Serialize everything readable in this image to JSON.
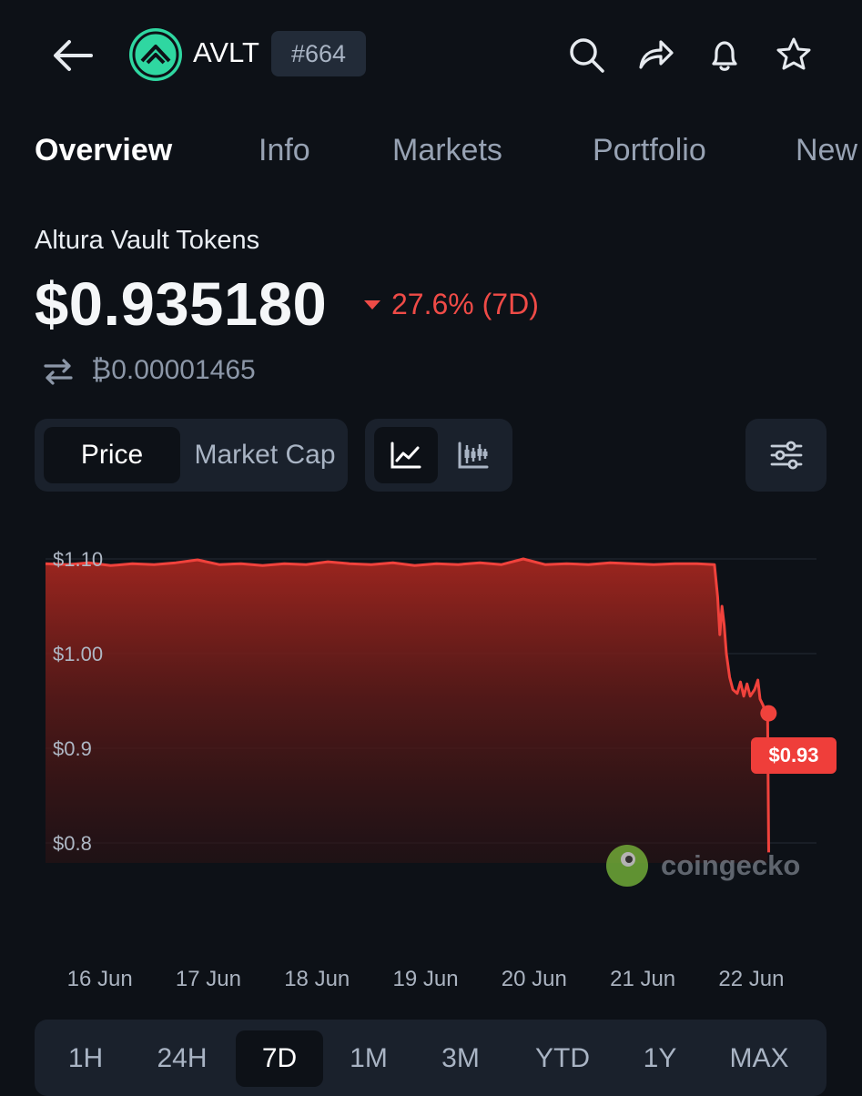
{
  "header": {
    "back_icon": "arrow-left-icon",
    "coin_logo_icon": "avlt-logo-icon",
    "symbol": "AVLT",
    "rank": "#664",
    "actions": [
      "search-icon",
      "share-icon",
      "bell-icon",
      "star-icon"
    ]
  },
  "tabs": [
    {
      "label": "Overview",
      "active": true
    },
    {
      "label": "Info"
    },
    {
      "label": "Markets"
    },
    {
      "label": "Portfolio"
    },
    {
      "label": "New"
    }
  ],
  "coin": {
    "name": "Altura Vault Tokens",
    "price": "$0.935180",
    "change": "27.6% (7D)",
    "change_direction": "down",
    "btc_price": "₿0.00001465"
  },
  "toggles": {
    "metric": [
      "Price",
      "Market Cap"
    ],
    "metric_selected": "Price",
    "chart_types": [
      "line-chart-icon",
      "candlestick-icon"
    ],
    "chart_type_selected": "line-chart-icon",
    "settings_icon": "sliders-icon"
  },
  "colors": {
    "background": "#0d1117",
    "down": "#ef4b47",
    "panel": "#1a212c",
    "coin_logo": "#2fd7a1"
  },
  "chart_data": {
    "type": "area",
    "y_ticks": [
      "$1.10",
      "$1.00",
      "$0.9",
      "$0.8"
    ],
    "y_tick_values": [
      1.1,
      1.0,
      0.9,
      0.8
    ],
    "ylim": [
      0.77,
      1.1
    ],
    "x_ticks": [
      "16 Jun",
      "17 Jun",
      "18 Jun",
      "19 Jun",
      "20 Jun",
      "21 Jun",
      "22 Jun"
    ],
    "x_tick_positions": [
      0.5,
      1.5,
      2.5,
      3.5,
      4.5,
      5.5,
      6.5
    ],
    "xlim": [
      0,
      7.1
    ],
    "series": [
      {
        "values": [
          [
            0.0,
            1.095
          ],
          [
            0.2,
            1.094
          ],
          [
            0.4,
            1.096
          ],
          [
            0.6,
            1.093
          ],
          [
            0.8,
            1.095
          ],
          [
            1.0,
            1.094
          ],
          [
            1.2,
            1.096
          ],
          [
            1.4,
            1.099
          ],
          [
            1.6,
            1.094
          ],
          [
            1.8,
            1.095
          ],
          [
            2.0,
            1.093
          ],
          [
            2.2,
            1.095
          ],
          [
            2.4,
            1.094
          ],
          [
            2.6,
            1.097
          ],
          [
            2.8,
            1.095
          ],
          [
            3.0,
            1.094
          ],
          [
            3.2,
            1.096
          ],
          [
            3.4,
            1.093
          ],
          [
            3.6,
            1.095
          ],
          [
            3.8,
            1.094
          ],
          [
            4.0,
            1.096
          ],
          [
            4.2,
            1.094
          ],
          [
            4.4,
            1.1
          ],
          [
            4.6,
            1.094
          ],
          [
            4.8,
            1.095
          ],
          [
            5.0,
            1.094
          ],
          [
            5.2,
            1.096
          ],
          [
            5.4,
            1.095
          ],
          [
            5.6,
            1.094
          ],
          [
            5.8,
            1.095
          ],
          [
            6.0,
            1.095
          ],
          [
            6.16,
            1.094
          ],
          [
            6.19,
            1.06
          ],
          [
            6.21,
            1.02
          ],
          [
            6.23,
            1.05
          ],
          [
            6.25,
            1.03
          ],
          [
            6.27,
            1.0
          ],
          [
            6.3,
            0.975
          ],
          [
            6.33,
            0.962
          ],
          [
            6.37,
            0.958
          ],
          [
            6.4,
            0.97
          ],
          [
            6.43,
            0.955
          ],
          [
            6.46,
            0.968
          ],
          [
            6.49,
            0.955
          ],
          [
            6.53,
            0.962
          ],
          [
            6.56,
            0.972
          ],
          [
            6.58,
            0.952
          ],
          [
            6.61,
            0.945
          ],
          [
            6.63,
            0.935
          ],
          [
            6.65,
            0.935
          ],
          [
            6.66,
            0.79
          ]
        ]
      }
    ],
    "last_label": "$0.93",
    "last_value": 0.935,
    "grid": true,
    "watermark": "coingecko"
  },
  "ranges": [
    {
      "label": "1H"
    },
    {
      "label": "24H"
    },
    {
      "label": "7D",
      "active": true
    },
    {
      "label": "1M"
    },
    {
      "label": "3M"
    },
    {
      "label": "YTD"
    },
    {
      "label": "1Y"
    },
    {
      "label": "MAX"
    }
  ]
}
